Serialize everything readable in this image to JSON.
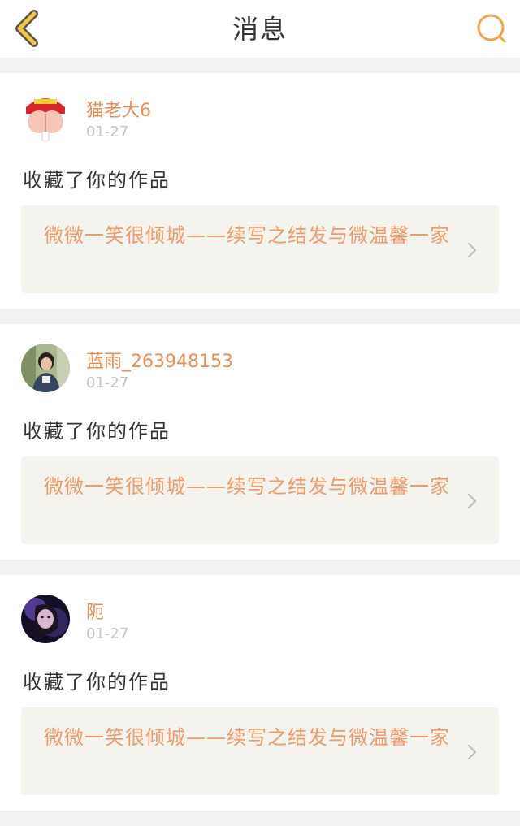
{
  "header": {
    "title": "消息",
    "back_icon": "chevron-left-icon",
    "search_icon": "search-icon",
    "accent_color": "#f5a14a"
  },
  "messages": [
    {
      "username": "猫老大6",
      "date": "01-27",
      "action": "收藏了你的作品",
      "work_title": "微微一笑很倾城——续写之结发与微温馨一家"
    },
    {
      "username": "蓝雨_263948153",
      "date": "01-27",
      "action": "收藏了你的作品",
      "work_title": "微微一笑很倾城——续写之结发与微温馨一家"
    },
    {
      "username": "阨",
      "date": "01-27",
      "action": "收藏了你的作品",
      "work_title": "微微一笑很倾城——续写之结发与微温馨一家"
    }
  ]
}
